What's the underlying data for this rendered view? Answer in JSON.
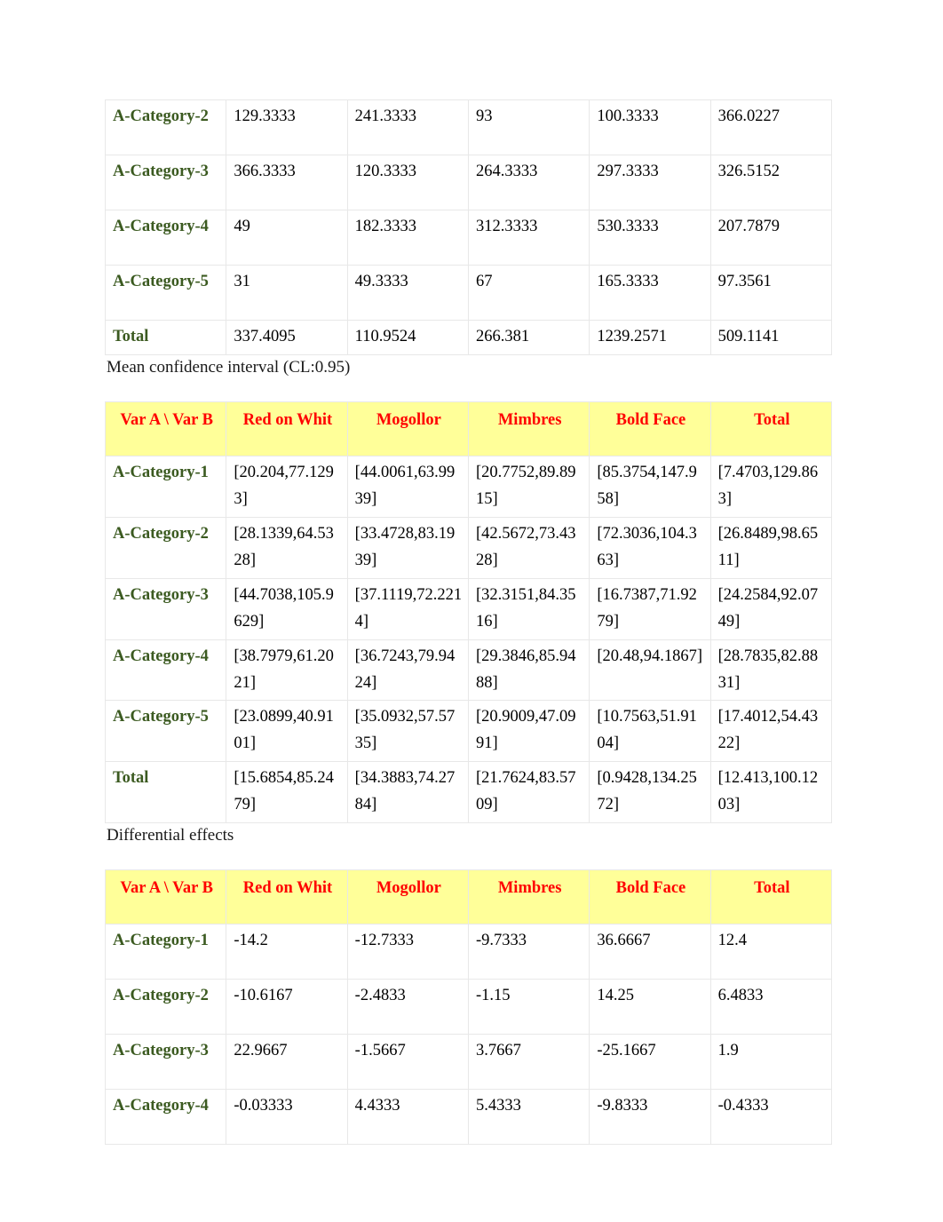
{
  "document": {
    "page_background": "#ffffff",
    "header_bg_color": "#ffff99",
    "header_text_color": "#ff0000",
    "row_label_color": "#3b5a20",
    "border_color": "#e8e8e8"
  },
  "columns": {
    "headers": [
      "Var A \\ Var B",
      "Red on Whit",
      "Mogollor",
      "Mimbres",
      "Bold Face",
      "Total"
    ]
  },
  "table1": {
    "name": "cell-means-continued",
    "rows": [
      {
        "label": "A-Category-2",
        "values": [
          "129.3333",
          "241.3333",
          "93",
          "100.3333",
          "366.0227"
        ]
      },
      {
        "label": "A-Category-3",
        "values": [
          "366.3333",
          "120.3333",
          "264.3333",
          "297.3333",
          "326.5152"
        ]
      },
      {
        "label": "A-Category-4",
        "values": [
          "49",
          "182.3333",
          "312.3333",
          "530.3333",
          "207.7879"
        ]
      },
      {
        "label": "A-Category-5",
        "values": [
          "31",
          "49.3333",
          "67",
          "165.3333",
          "97.3561"
        ]
      },
      {
        "label": "Total",
        "values": [
          "337.4095",
          "110.9524",
          "266.381",
          "1239.2571",
          "509.1141"
        ]
      }
    ]
  },
  "caption1": "Mean confidence interval (CL:0.95)",
  "table2": {
    "name": "mean-confidence-interval",
    "rows": [
      {
        "label": "A-Category-1",
        "values": [
          "[20.204,77.1293]",
          "[44.0061,63.9939]",
          "[20.7752,89.8915]",
          "[85.3754,147.958]",
          "[7.4703,129.863]"
        ]
      },
      {
        "label": "A-Category-2",
        "values": [
          "[28.1339,64.5328]",
          "[33.4728,83.1939]",
          "[42.5672,73.4328]",
          "[72.3036,104.363]",
          "[26.8489,98.6511]"
        ]
      },
      {
        "label": "A-Category-3",
        "values": [
          "[44.7038,105.9629]",
          "[37.1119,72.2214]",
          "[32.3151,84.3516]",
          "[16.7387,71.9279]",
          "[24.2584,92.0749]"
        ]
      },
      {
        "label": "A-Category-4",
        "values": [
          "[38.7979,61.2021]",
          "[36.7243,79.9424]",
          "[29.3846,85.9488]",
          "[20.48,94.1867]",
          "[28.7835,82.8831]"
        ]
      },
      {
        "label": "A-Category-5",
        "values": [
          "[23.0899,40.9101]",
          "[35.0932,57.5735]",
          "[20.9009,47.0991]",
          "[10.7563,51.9104]",
          "[17.4012,54.4322]"
        ]
      },
      {
        "label": "Total",
        "values": [
          "[15.6854,85.2479]",
          "[34.3883,74.2784]",
          "[21.7624,83.5709]",
          "[0.9428,134.2572]",
          "[12.413,100.1203]"
        ]
      }
    ]
  },
  "caption2": "Differential effects",
  "table3": {
    "name": "differential-effects",
    "rows": [
      {
        "label": "A-Category-1",
        "values": [
          "-14.2",
          "-12.7333",
          "-9.7333",
          "36.6667",
          "12.4"
        ]
      },
      {
        "label": "A-Category-2",
        "values": [
          "-10.6167",
          "-2.4833",
          "-1.15",
          "14.25",
          "6.4833"
        ]
      },
      {
        "label": "A-Category-3",
        "values": [
          "22.9667",
          "-1.5667",
          "3.7667",
          "-25.1667",
          "1.9"
        ]
      },
      {
        "label": "A-Category-4",
        "values": [
          "-0.03333",
          "4.4333",
          "5.4333",
          "-9.8333",
          "-0.4333"
        ]
      }
    ]
  }
}
